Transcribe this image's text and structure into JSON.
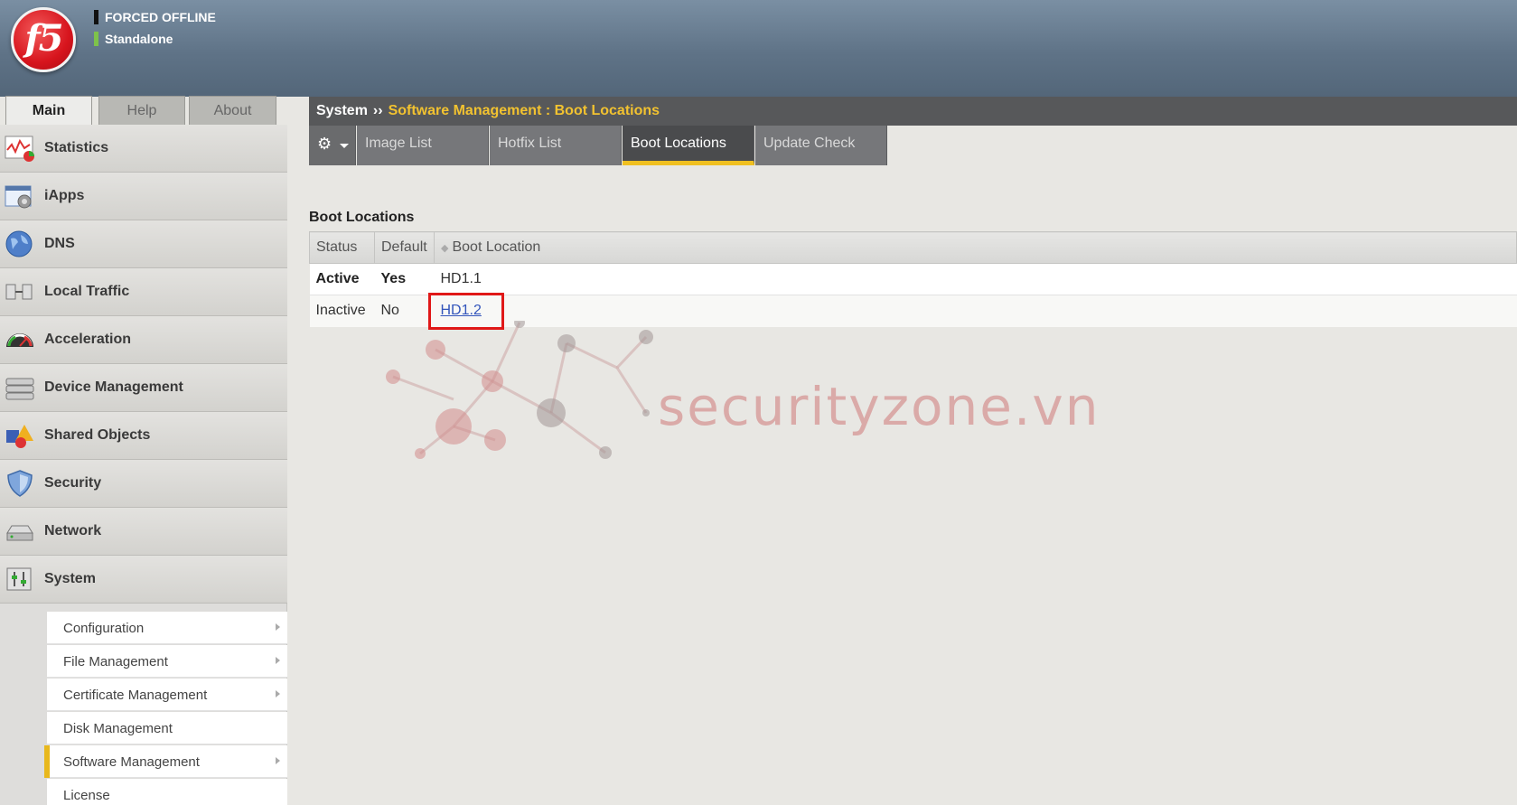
{
  "header": {
    "logo_text": "f5",
    "status_primary": "FORCED OFFLINE",
    "status_secondary": "Standalone"
  },
  "left_tabs": [
    "Main",
    "Help",
    "About"
  ],
  "nav": {
    "items": [
      {
        "label": "Statistics",
        "icon": "statistics-icon"
      },
      {
        "label": "iApps",
        "icon": "iapps-icon"
      },
      {
        "label": "DNS",
        "icon": "dns-icon"
      },
      {
        "label": "Local Traffic",
        "icon": "local-traffic-icon"
      },
      {
        "label": "Acceleration",
        "icon": "acceleration-icon"
      },
      {
        "label": "Device Management",
        "icon": "device-management-icon"
      },
      {
        "label": "Shared Objects",
        "icon": "shared-objects-icon"
      },
      {
        "label": "Security",
        "icon": "security-icon"
      },
      {
        "label": "Network",
        "icon": "network-icon"
      },
      {
        "label": "System",
        "icon": "system-icon"
      }
    ],
    "system_submenu": [
      {
        "label": "Configuration",
        "has_arrow": true
      },
      {
        "label": "File Management",
        "has_arrow": true
      },
      {
        "label": "Certificate Management",
        "has_arrow": true
      },
      {
        "label": "Disk Management",
        "has_arrow": false
      },
      {
        "label": "Software Management",
        "has_arrow": true,
        "active": true
      },
      {
        "label": "License",
        "has_arrow": false
      }
    ]
  },
  "breadcrumb": {
    "root": "System",
    "separator": "››",
    "path": "Software Management : Boot Locations"
  },
  "subtabs": {
    "gear": "⚙",
    "items": [
      "Image List",
      "Hotfix List",
      "Boot Locations",
      "Update Check"
    ],
    "active": "Boot Locations"
  },
  "section_title": "Boot Locations",
  "table": {
    "columns": [
      "Status",
      "Default",
      "Boot Location"
    ],
    "rows": [
      {
        "status": "Active",
        "default": "Yes",
        "location": "HD1.1"
      },
      {
        "status": "Inactive",
        "default": "No",
        "location": "HD1.2"
      }
    ]
  },
  "watermark": "securityzone.vn",
  "colors": {
    "accent_yellow": "#f0c020",
    "breadcrumb_path": "#f2c230",
    "highlight_red": "#e01818",
    "link_blue": "#3355bb"
  }
}
